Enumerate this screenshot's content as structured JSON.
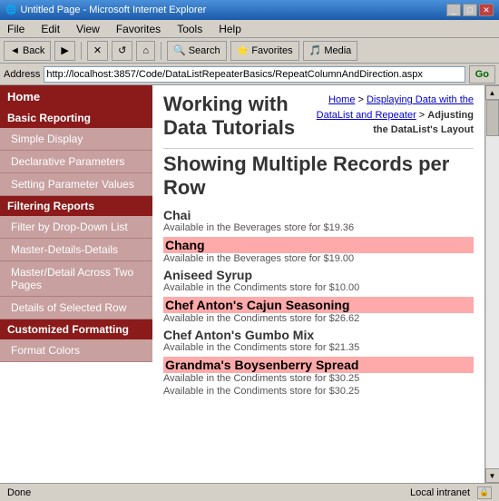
{
  "titlebar": {
    "title": "Untitled Page - Microsoft Internet Explorer",
    "buttons": [
      "_",
      "□",
      "✕"
    ]
  },
  "menubar": {
    "items": [
      "File",
      "Edit",
      "View",
      "Favorites",
      "Tools",
      "Help"
    ]
  },
  "toolbar": {
    "back": "◄ Back",
    "forward": "▶",
    "stop": "✕",
    "refresh": "↺",
    "home": "⌂",
    "search": "Search",
    "favorites": "Favorites",
    "media": "Media"
  },
  "addressbar": {
    "label": "Address",
    "url": "http://localhost:3857/Code/DataListRepeaterBasics/RepeatColumnAndDirection.aspx",
    "go": "Go"
  },
  "breadcrumb": {
    "home": "Home",
    "sep1": " > ",
    "link1": "Displaying Data with the DataList and Repeater",
    "sep2": " > ",
    "current": "Adjusting the DataList's Layout"
  },
  "sitetitle": "Working with Data Tutorials",
  "nav": {
    "home": "Home",
    "sections": [
      {
        "header": "Basic Reporting",
        "items": [
          "Simple Display",
          "Declarative Parameters",
          "Setting Parameter Values"
        ]
      },
      {
        "header": "Filtering Reports",
        "items": [
          "Filter by Drop-Down List",
          "Master-Details-Details",
          "Master/Detail Across Two Pages",
          "Details of Selected Row"
        ]
      },
      {
        "header": "Customized Formatting",
        "items": [
          "Format Colors"
        ]
      }
    ]
  },
  "content": {
    "title": "Showing Multiple Records per Row",
    "products": [
      {
        "name": "Chai",
        "desc": "Available in the Beverages store for $19.36",
        "highlight": false
      },
      {
        "name": "Chang",
        "desc": "Available in the Beverages store for $19.00",
        "highlight": true
      },
      {
        "name": "Aniseed Syrup",
        "desc": "Available in the Condiments store for $10.00",
        "highlight": false
      },
      {
        "name": "Chef Anton's Cajun Seasoning",
        "desc": "Available in the Condiments store for $26.62",
        "highlight": true
      },
      {
        "name": "Chef Anton's Gumbo Mix",
        "desc": "Available in the Condiments store for $21.35",
        "highlight": false
      },
      {
        "name": "Grandma's Boysenberry Spread",
        "desc": "Available in the Condiments store for $30.25",
        "highlight": true
      },
      {
        "name": "",
        "desc": "Available in the Condiments store for $30.25",
        "highlight": false,
        "partial": true
      }
    ]
  },
  "statusbar": {
    "status": "Done",
    "zone": "Local intranet"
  }
}
